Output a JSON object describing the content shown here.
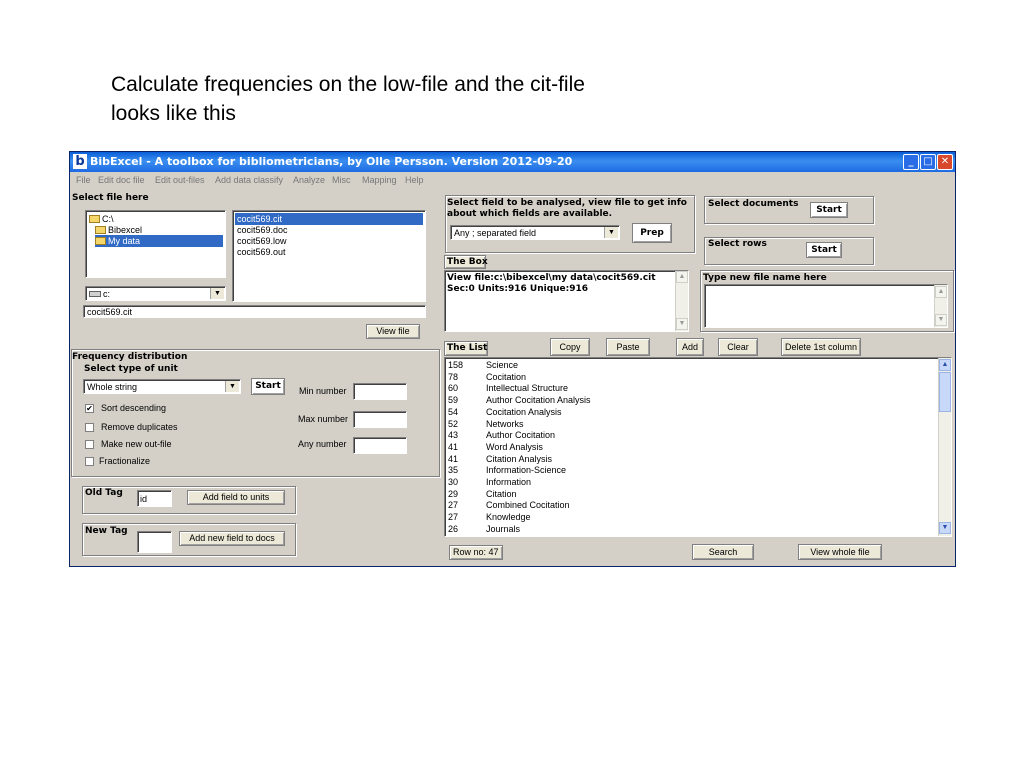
{
  "slide": {
    "caption_line1": "Calculate frequencies on the low-file and the cit-file",
    "caption_line2": "looks like this"
  },
  "window": {
    "title": "BibExcel - A toolbox for bibliometricians, by Olle Persson. Version 2012-09-20",
    "icon_text": "b",
    "minimize": "_",
    "maximize": "□",
    "close": "✕"
  },
  "menu": [
    "File",
    "Edit doc file",
    "Edit out-files",
    "Add data classify",
    "Analyze",
    "Misc",
    "Mapping",
    "Help"
  ],
  "select_file": {
    "heading": "Select file here",
    "folders": [
      "C:\\",
      "Bibexcel",
      "My data"
    ],
    "files": [
      "cocit569.cit",
      "cocit569.doc",
      "cocit569.low",
      "cocit569.out"
    ],
    "drive": "c:",
    "filename": "cocit569.cit",
    "view_file_button": "View file"
  },
  "frequency": {
    "heading": "Frequency distribution",
    "subheading": "Select type of unit",
    "unit_type": "Whole string",
    "start_button": "Start",
    "min_label": "Min number",
    "max_label": "Max number",
    "any_label": "Any number",
    "options": [
      {
        "label": "Sort descending",
        "checked": true
      },
      {
        "label": "Remove duplicates",
        "checked": false
      },
      {
        "label": "Make new out-file",
        "checked": false
      },
      {
        "label": "Fractionalize",
        "checked": false
      }
    ]
  },
  "old_tag": {
    "label": "Old Tag",
    "value": "id",
    "button": "Add field to units"
  },
  "new_tag": {
    "label": "New Tag",
    "value": "",
    "button": "Add new field to docs"
  },
  "select_field": {
    "heading_line1": "Select field to be analysed, view file to get info",
    "heading_line2": "about which fields are available.",
    "field_value": "Any ; separated field",
    "prep_button": "Prep"
  },
  "select_documents": {
    "label": "Select documents",
    "button": "Start"
  },
  "select_rows": {
    "label": "Select rows",
    "button": "Start"
  },
  "the_box": {
    "heading": "The Box",
    "line1": "View file:c:\\bibexcel\\my data\\cocit569.cit",
    "line2": "Sec:0 Units:916 Unique:916"
  },
  "new_file_name": {
    "label": "Type new file name here",
    "value": ""
  },
  "the_list": {
    "heading": "The List",
    "buttons": {
      "copy": "Copy",
      "paste": "Paste",
      "add": "Add",
      "clear": "Clear",
      "delete_first_column": "Delete 1st column"
    },
    "rows": [
      {
        "count": "158",
        "term": "Science"
      },
      {
        "count": "78",
        "term": "Cocitation"
      },
      {
        "count": "60",
        "term": "Intellectual Structure"
      },
      {
        "count": "59",
        "term": "Author Cocitation Analysis"
      },
      {
        "count": "54",
        "term": "Cocitation Analysis"
      },
      {
        "count": "52",
        "term": "Networks"
      },
      {
        "count": "43",
        "term": "Author Cocitation"
      },
      {
        "count": "41",
        "term": "Word Analysis"
      },
      {
        "count": "41",
        "term": "Citation Analysis"
      },
      {
        "count": "35",
        "term": "Information-Science"
      },
      {
        "count": "30",
        "term": "Information"
      },
      {
        "count": "29",
        "term": "Citation"
      },
      {
        "count": "27",
        "term": "Combined Cocitation"
      },
      {
        "count": "27",
        "term": "Knowledge"
      },
      {
        "count": "26",
        "term": "Journals"
      }
    ]
  },
  "bottom": {
    "row_number": "Row no: 47",
    "search_button": "Search",
    "view_whole_file_button": "View whole file"
  }
}
